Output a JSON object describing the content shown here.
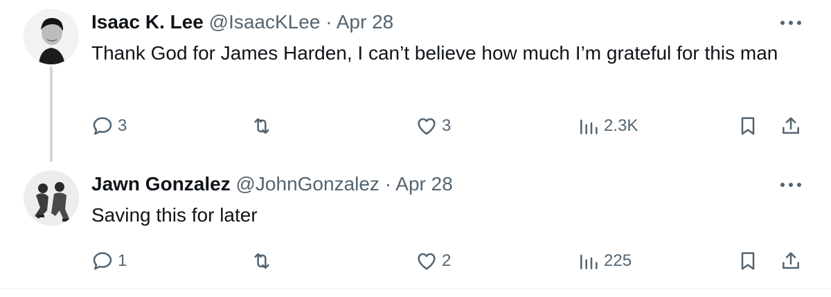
{
  "tweets": [
    {
      "author": {
        "name": "Isaac K. Lee",
        "handle": "@IsaacKLee"
      },
      "separator": "·",
      "date": "Apr 28",
      "text": "Thank God for James Harden, I can’t believe how much I’m grateful for this man",
      "metrics": {
        "replies": "3",
        "likes": "3",
        "views": "2.3K"
      }
    },
    {
      "author": {
        "name": "Jawn Gonzalez",
        "handle": "@JohnGonzalez"
      },
      "separator": "·",
      "date": "Apr 28",
      "text": "Saving this for later",
      "metrics": {
        "replies": "1",
        "likes": "2",
        "views": "225"
      }
    }
  ],
  "icons": {
    "reply": "reply-icon",
    "retweet": "retweet-icon",
    "like": "heart-icon",
    "views": "views-icon",
    "bookmark": "bookmark-icon",
    "share": "share-icon",
    "more": "more-icon"
  },
  "colors": {
    "text": "#0f1419",
    "secondary": "#536471",
    "thread_line": "#cfd9de"
  }
}
